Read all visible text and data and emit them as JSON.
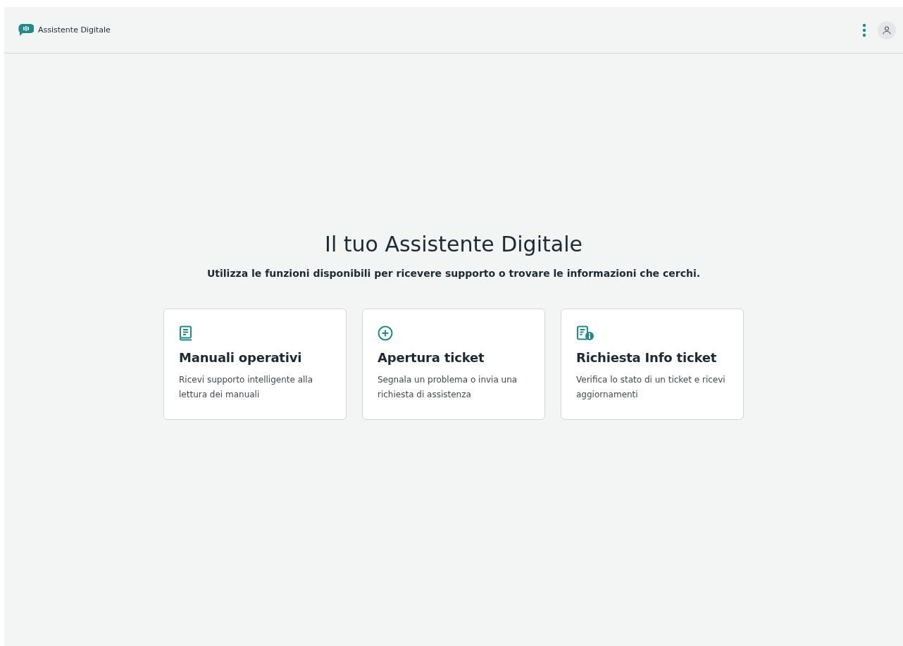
{
  "header": {
    "app_name": "Assistente Digitale"
  },
  "hero": {
    "title": "Il tuo Assistente Digitale",
    "subtitle": "Utilizza le funzioni disponibili per ricevere supporto o trovare le informazioni che cerchi."
  },
  "cards": [
    {
      "kind": "book",
      "title": "Manuali operativi",
      "description": "Ricevi supporto intelligente alla lettura dei manuali"
    },
    {
      "kind": "add",
      "title": "Apertura ticket",
      "description": "Segnala un problema o invia una richiesta di assistenza"
    },
    {
      "kind": "info",
      "title": "Richiesta Info ticket",
      "description": "Verifica lo stato di un ticket e ricevi aggiornamenti"
    }
  ]
}
